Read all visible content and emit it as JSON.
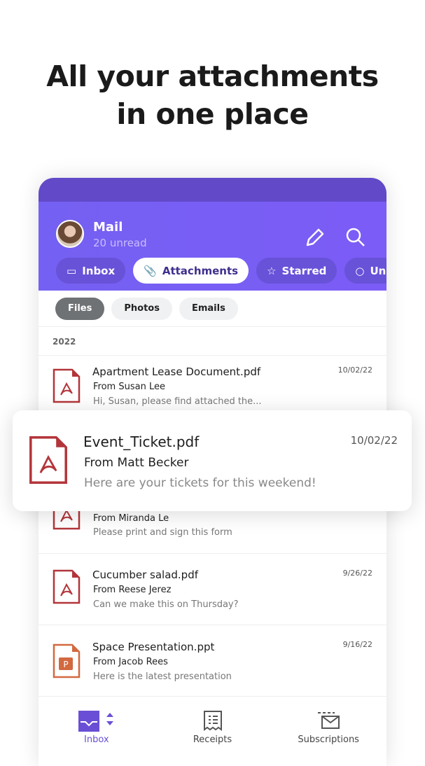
{
  "headline": {
    "line1": "All your attachments",
    "line2": "in one place"
  },
  "header": {
    "title": "Mail",
    "subtitle": "20 unread"
  },
  "tabs": [
    {
      "label": "Inbox",
      "icon": "inbox-icon"
    },
    {
      "label": "Attachments",
      "icon": "paperclip-icon"
    },
    {
      "label": "Starred",
      "icon": "star-icon"
    },
    {
      "label": "Un",
      "icon": "circle-icon"
    }
  ],
  "chips": [
    "Files",
    "Photos",
    "Emails"
  ],
  "section": "2022",
  "rows": [
    {
      "name": "Apartment Lease Document.pdf",
      "from": "From Susan Lee",
      "preview": "Hi, Susan, please find attached the...",
      "date": "10/02/22",
      "type": "pdf"
    },
    {
      "name": "",
      "from": "From Miranda Le",
      "preview": "Please print and sign this form",
      "date": "",
      "type": "pdf"
    },
    {
      "name": "Cucumber salad.pdf",
      "from": "From Reese Jerez",
      "preview": "Can we make this on Thursday?",
      "date": "9/26/22",
      "type": "pdf"
    },
    {
      "name": "Space Presentation.ppt",
      "from": "From Jacob Rees",
      "preview": "Here is the latest presentation",
      "date": "9/16/22",
      "type": "ppt"
    }
  ],
  "featured": {
    "name": "Event_Ticket.pdf",
    "from": "From Matt Becker",
    "preview": "Here are your tickets for this weekend!",
    "date": "10/02/22"
  },
  "nav": [
    {
      "label": "Inbox"
    },
    {
      "label": "Receipts"
    },
    {
      "label": "Subscriptions"
    }
  ],
  "colors": {
    "accent": "#7b5cf5",
    "pdf": "#b3353a",
    "ppt": "#d2693f"
  }
}
